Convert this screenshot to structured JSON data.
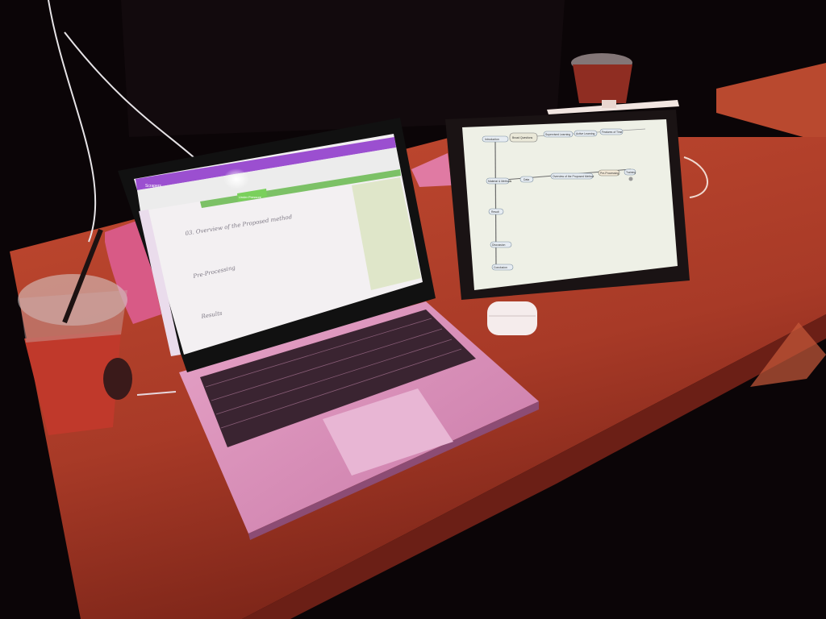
{
  "colors": {
    "background": "#0b0507",
    "table": "#b8432d",
    "laptop_body": "#d98ab5",
    "onenote_ribbon": "#9b4fd0",
    "tablet_screen": "#eef0e6"
  },
  "laptop": {
    "app_menu": "Scrapers",
    "section_tab": "Under Pressure",
    "handwriting": {
      "line1": "03. Overview of the Proposed method",
      "line2": "Pre-Processing",
      "line3": "Results"
    }
  },
  "tablet": {
    "nodes": [
      "Introduction",
      "Broad Questions",
      "Supervised Learning",
      "Active Learning",
      "Features of Time",
      "Material & Methods",
      "Data",
      "Overview of the Proposed Method",
      "Pre-Processing",
      "Training",
      "Result",
      "Discussion",
      "Conclusion"
    ]
  },
  "objects": {
    "airpods_case": "airpods-case",
    "pencil": "apple-pencil",
    "cup_left": "iced-drink-cup",
    "cup_back": "iced-drink-cup-back"
  }
}
